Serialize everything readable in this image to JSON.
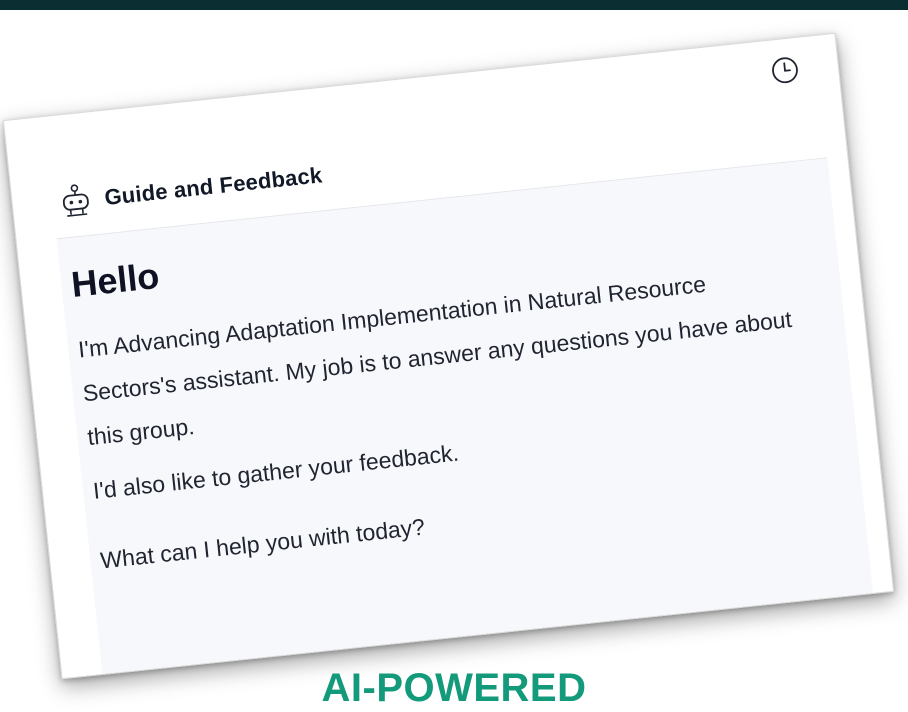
{
  "header": {
    "title": "Guide and Feedback",
    "bot_icon": "robot-icon",
    "history_icon": "clock-icon"
  },
  "chat": {
    "greeting": "Hello",
    "messages": [
      "I'm Advancing Adaptation Implementation in Natural Resource Sectors's assistant. My job is to answer any questions you have about this group.",
      "I'd also like to gather your feedback.",
      "What can I help you with today?"
    ]
  },
  "banner": {
    "text": "AI-POWERED"
  },
  "colors": {
    "topbar": "#0b2e33",
    "banner_text": "#139a7a",
    "panel_bg": "#f7f8fb"
  }
}
